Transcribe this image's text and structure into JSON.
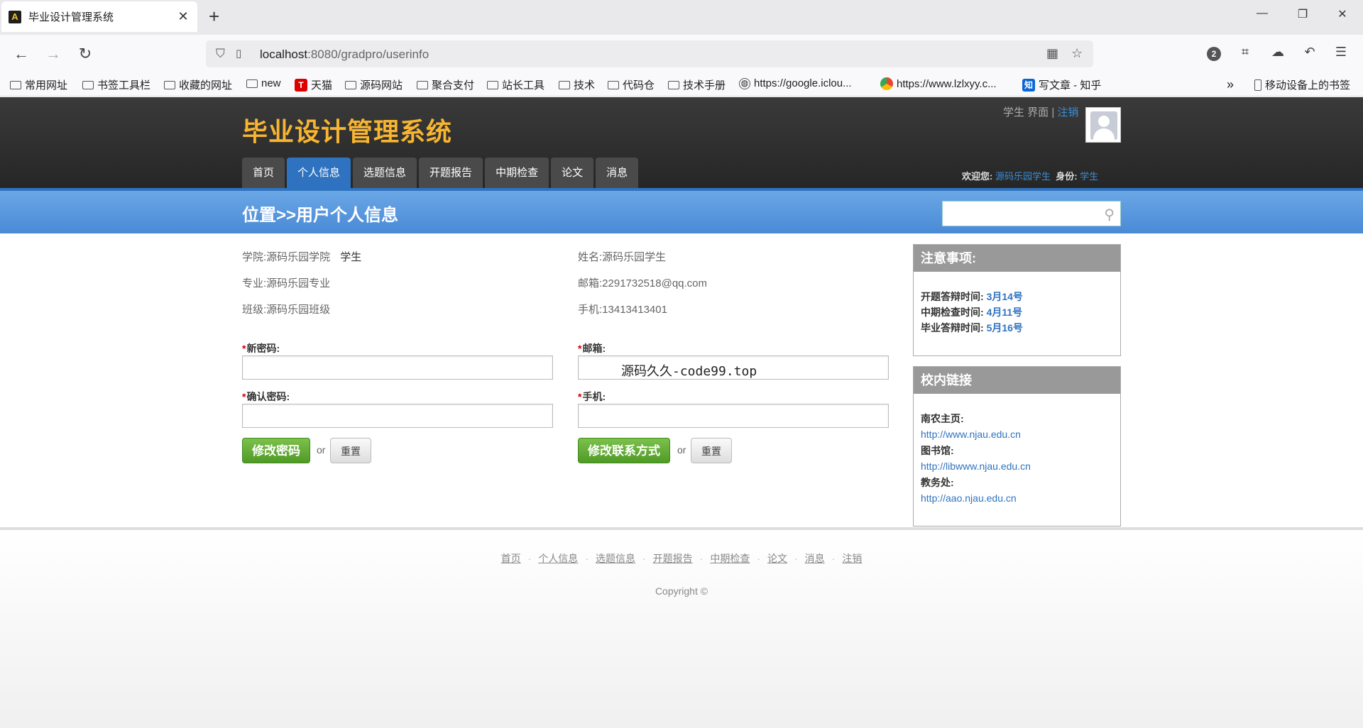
{
  "browser": {
    "tab_title": "毕业设计管理系统",
    "tab_favicon": "A",
    "url_host": "localhost",
    "url_path": ":8080/gradpro/userinfo",
    "extension_badge": "2",
    "bookmarks": [
      {
        "label": "常用网址",
        "icon": "folder-icon"
      },
      {
        "label": "书签工具栏",
        "icon": "folder-icon"
      },
      {
        "label": "收藏的网址",
        "icon": "folder-icon"
      },
      {
        "label": "new",
        "icon": "folder-icon"
      },
      {
        "label": "天猫",
        "icon": "tmall-icon"
      },
      {
        "label": "源码网站",
        "icon": "folder-icon"
      },
      {
        "label": "聚合支付",
        "icon": "folder-icon"
      },
      {
        "label": "站长工具",
        "icon": "folder-icon"
      },
      {
        "label": "技术",
        "icon": "folder-icon"
      },
      {
        "label": "代码仓",
        "icon": "folder-icon"
      },
      {
        "label": "技术手册",
        "icon": "folder-icon"
      },
      {
        "label": "https://google.iclou...",
        "icon": "globe-icon"
      },
      {
        "label": "https://www.lzlxyy.c...",
        "icon": "chrome-icon"
      },
      {
        "label": "写文章 - 知乎",
        "icon": "zhihu-icon"
      }
    ],
    "mobile_bookmarks": "移动设备上的书签"
  },
  "site": {
    "title": "毕业设计管理系统",
    "top_role": "学生 界面",
    "top_separator": " | ",
    "logout": "注销",
    "menu": [
      "首页",
      "个人信息",
      "选题信息",
      "开题报告",
      "中期检查",
      "论文",
      "消息"
    ],
    "active_menu": "个人信息",
    "welcome_label": "欢迎您:",
    "welcome_user": "源码乐园学生",
    "role_label": "身份:",
    "role_value": "学生",
    "location": "位置>>用户个人信息"
  },
  "profile": {
    "college_label": "学院:",
    "college": "源码乐园学院",
    "identity": "学生",
    "major_label": "专业:",
    "major": "源码乐园专业",
    "class_label": "班级:",
    "class": "源码乐园班级",
    "name_label": "姓名:",
    "name": "源码乐园学生",
    "email_label": "邮箱:",
    "email": "2291732518@qq.com",
    "phone_label": "手机:",
    "phone": "13413413401"
  },
  "password_form": {
    "required_mark": "*",
    "new_label": "新密码:",
    "confirm_label": "确认密码:",
    "submit": "修改密码",
    "or": "or",
    "reset": "重置"
  },
  "contact_form": {
    "required_mark": "*",
    "email_label": "邮箱:",
    "email_value": "源码久久-code99.top",
    "phone_label": "手机:",
    "submit": "修改联系方式",
    "or": "or",
    "reset": "重置"
  },
  "notice": {
    "title": "注意事项:",
    "items": [
      {
        "label": "开题答辩时间:",
        "value": "3月14号"
      },
      {
        "label": "中期检查时间:",
        "value": "4月11号"
      },
      {
        "label": "毕业答辩时间:",
        "value": "5月16号"
      }
    ]
  },
  "links": {
    "title": "校内链接",
    "items": [
      {
        "label": "南农主页:",
        "url": "http://www.njau.edu.cn"
      },
      {
        "label": "图书馆:",
        "url": "http://libwww.njau.edu.cn"
      },
      {
        "label": "教务处:",
        "url": "http://aao.njau.edu.cn"
      }
    ]
  },
  "footer": {
    "links": [
      "首页",
      "个人信息",
      "选题信息",
      "开题报告",
      "中期检查",
      "论文",
      "消息",
      "注销"
    ],
    "separator": "·",
    "copyright": "Copyright ©"
  }
}
